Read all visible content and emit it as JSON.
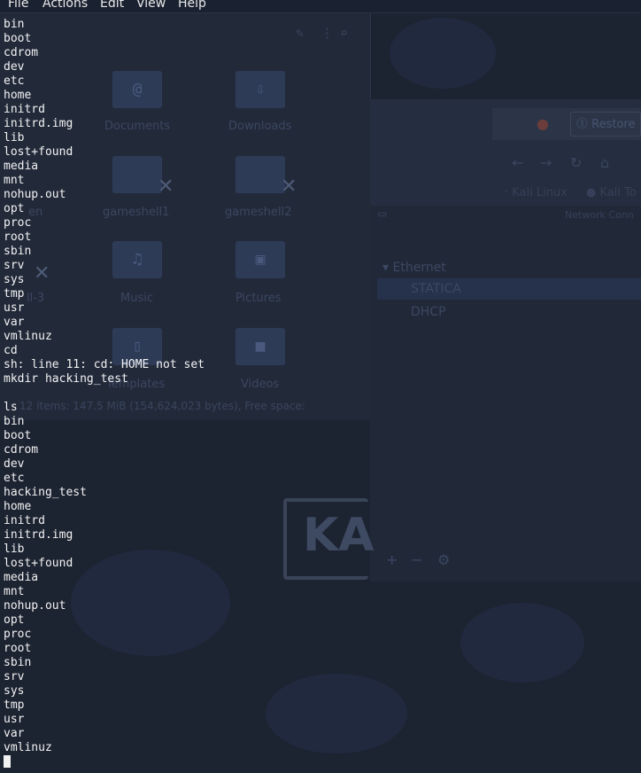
{
  "menubar": {
    "items": [
      "File",
      "Actions",
      "Edit",
      "View",
      "Help"
    ]
  },
  "terminal": {
    "lines": [
      "bin",
      "boot",
      "cdrom",
      "dev",
      "etc",
      "home",
      "initrd",
      "initrd.img",
      "lib",
      "lost+found",
      "media",
      "mnt",
      "nohup.out",
      "opt",
      "proc",
      "root",
      "sbin",
      "srv",
      "sys",
      "tmp",
      "usr",
      "var",
      "vmlinuz",
      "cd",
      "sh: line 11: cd: HOME not set",
      "mkdir hacking_test",
      "",
      "ls",
      "bin",
      "boot",
      "cdrom",
      "dev",
      "etc",
      "hacking_test",
      "home",
      "initrd",
      "initrd.img",
      "lib",
      "lost+found",
      "media",
      "mnt",
      "nohup.out",
      "opt",
      "proc",
      "root",
      "sbin",
      "srv",
      "sys",
      "tmp",
      "usr",
      "var",
      "vmlinuz"
    ]
  },
  "background": {
    "file_manager": {
      "items": [
        "Documents",
        "Downloads",
        "gameshell1",
        "gameshell2",
        "Music",
        "Pictures",
        "Templates",
        "Videos"
      ],
      "partial_items": [
        "en",
        "ll-3"
      ],
      "status": "12 items: 147.5 MiB (154,624,023 bytes), Free space:"
    },
    "browser": {
      "restore_label": "Restore",
      "bookmarks": [
        "Kali Linux",
        "Kali To"
      ]
    },
    "network_manager": {
      "header": "Network Conn",
      "group": "Ethernet",
      "connections": [
        "STATICA",
        "DHCP"
      ]
    },
    "logo_text": "KA"
  },
  "colors": {
    "terminal_background": "#1c2331",
    "terminal_text": "#f2f2f2"
  }
}
